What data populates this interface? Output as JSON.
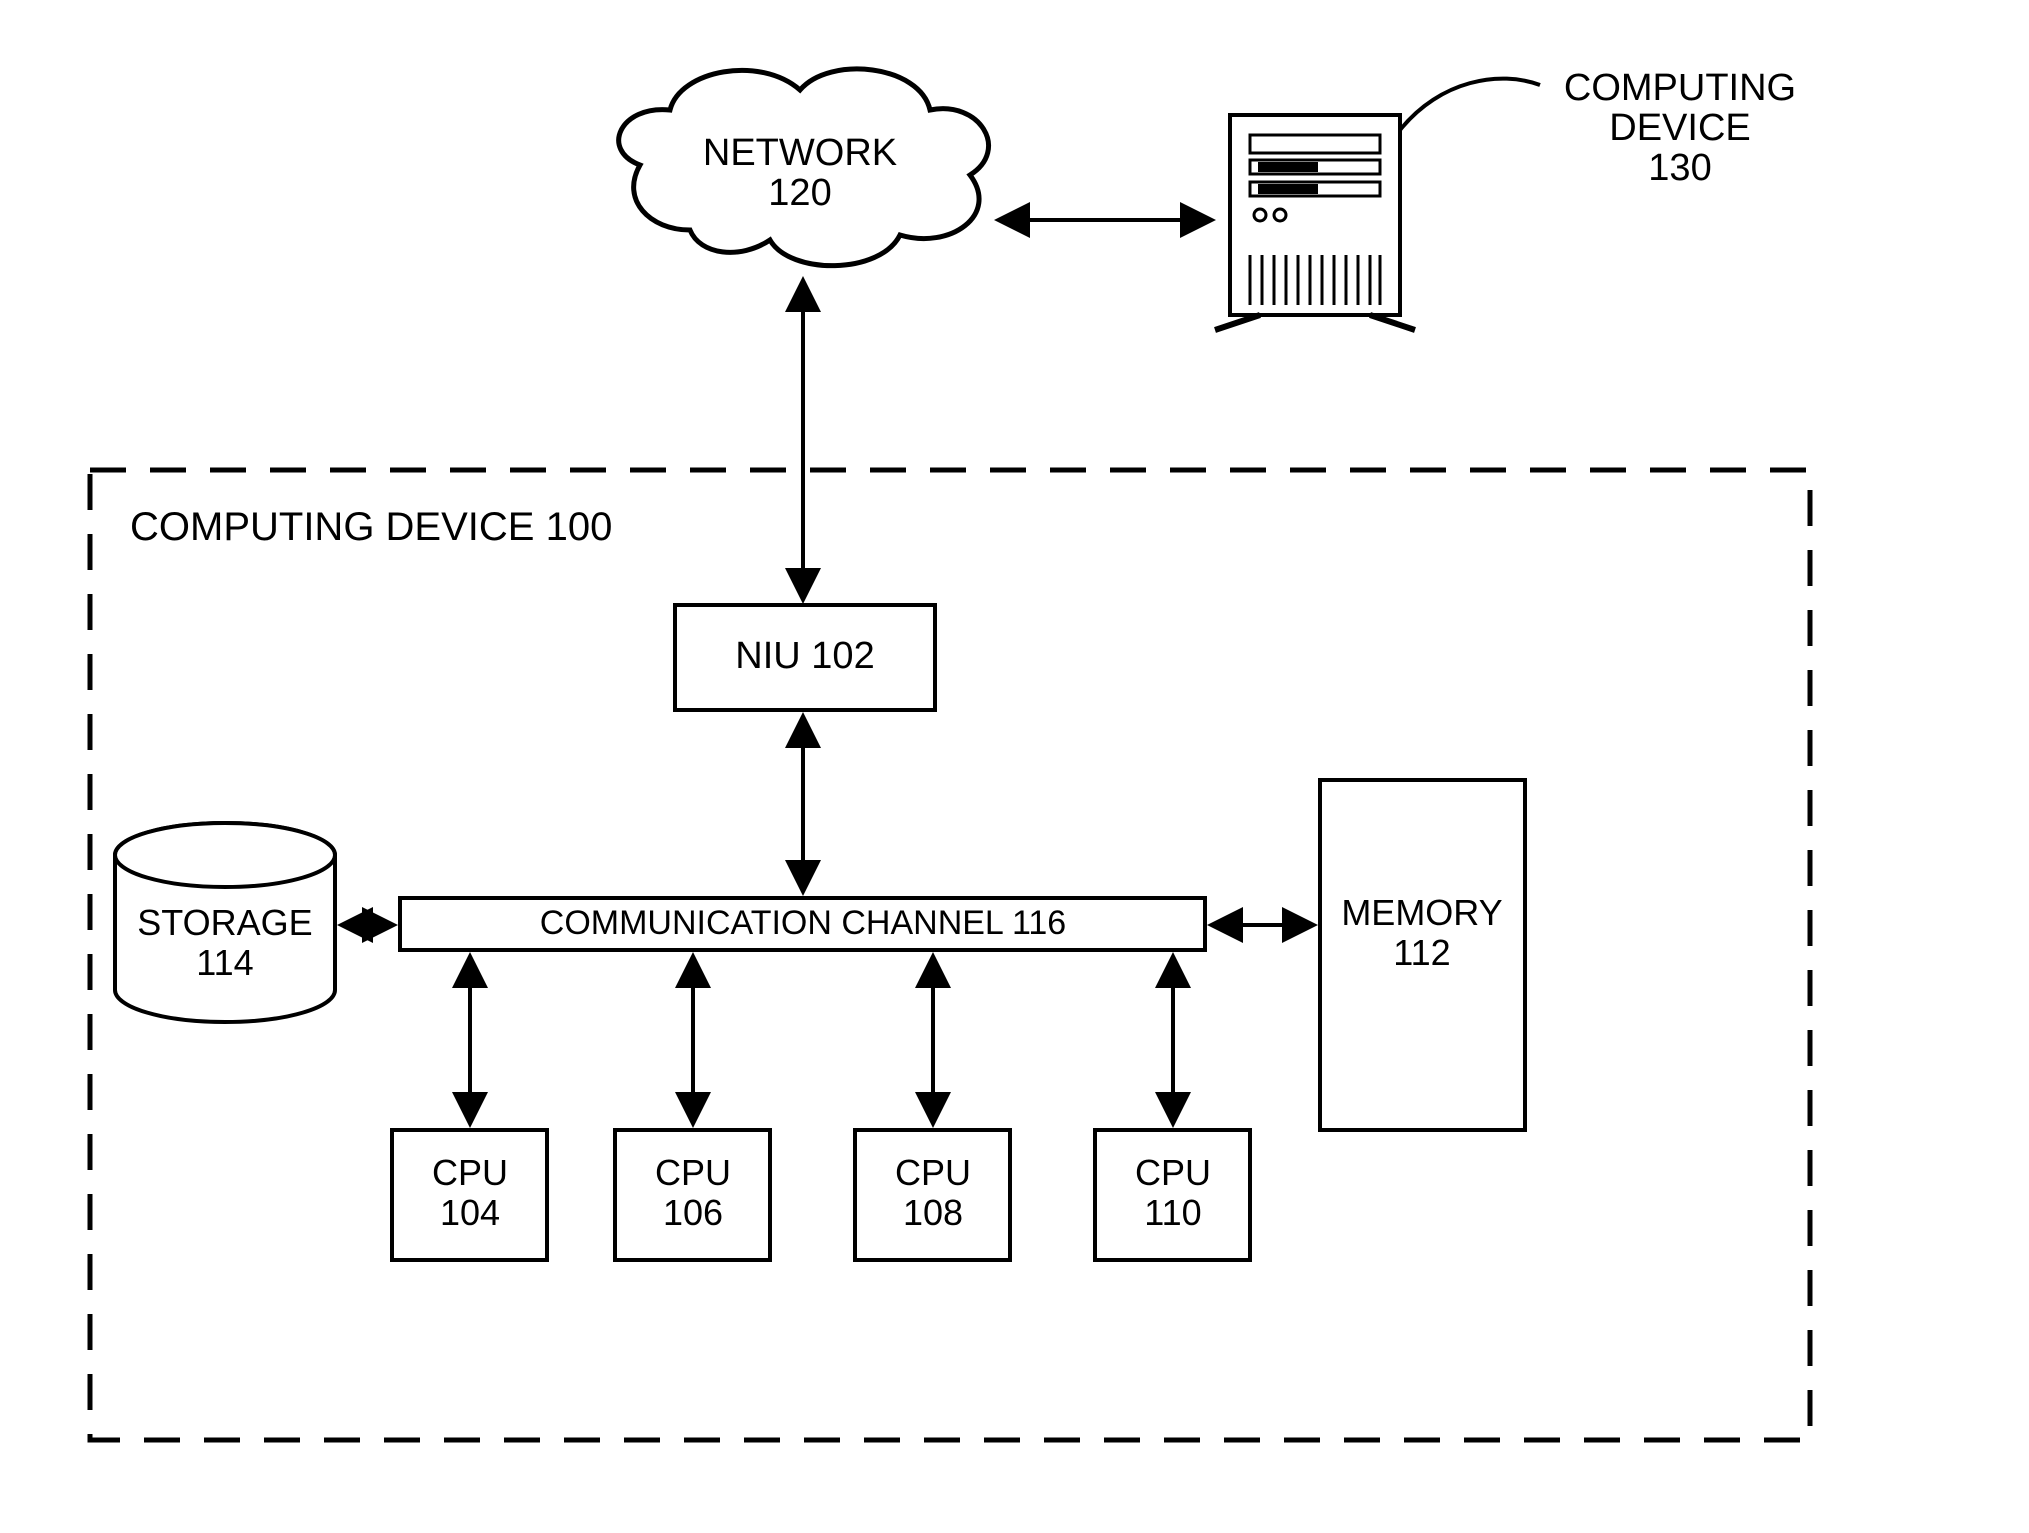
{
  "diagram": {
    "outer_label": "COMPUTING DEVICE 100",
    "network": {
      "l1": "NETWORK",
      "l2": "120"
    },
    "remote": {
      "l1": "COMPUTING",
      "l2": "DEVICE",
      "l3": "130"
    },
    "niu": "NIU 102",
    "channel": "COMMUNICATION CHANNEL 116",
    "storage": {
      "l1": "STORAGE",
      "l2": "114"
    },
    "memory": {
      "l1": "MEMORY",
      "l2": "112"
    },
    "cpus": [
      {
        "l1": "CPU",
        "l2": "104"
      },
      {
        "l1": "CPU",
        "l2": "106"
      },
      {
        "l1": "CPU",
        "l2": "108"
      },
      {
        "l1": "CPU",
        "l2": "110"
      }
    ]
  }
}
